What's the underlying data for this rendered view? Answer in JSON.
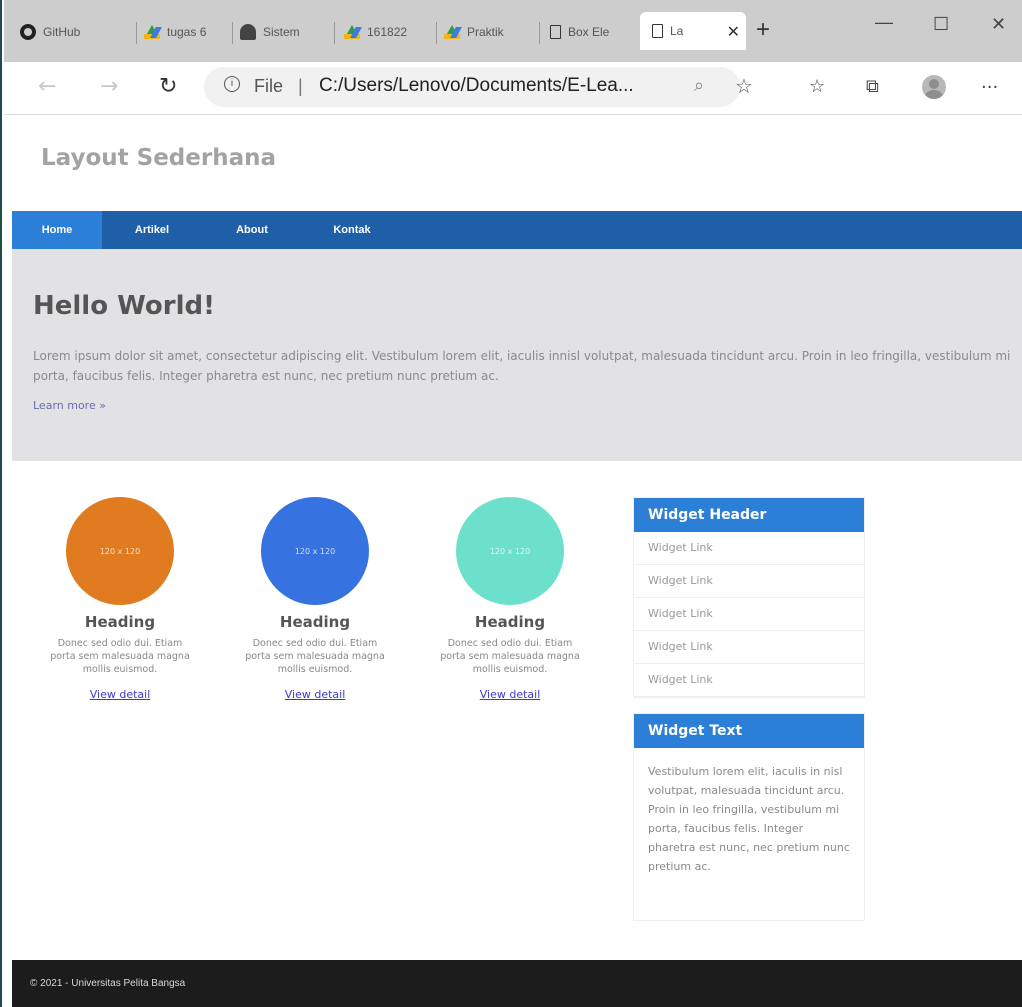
{
  "browser": {
    "tabs": [
      {
        "label": "GitHub",
        "icon": "github-icon"
      },
      {
        "label": "tugas 6",
        "icon": "google-drive-icon"
      },
      {
        "label": "Sistem",
        "icon": "hat-icon"
      },
      {
        "label": "161822",
        "icon": "google-drive-icon"
      },
      {
        "label": "Praktik",
        "icon": "google-drive-icon"
      },
      {
        "label": "Box Ele",
        "icon": "page-icon"
      },
      {
        "label": "La",
        "icon": "page-icon",
        "active": true
      }
    ],
    "new_tab": "+",
    "window_controls": {
      "minimize": "—",
      "maximize": "☐",
      "close": "✕"
    },
    "address": {
      "info": "i",
      "scheme": "File",
      "separator": "|",
      "url": "C:/Users/Lenovo/Documents/E-Lea..."
    },
    "more": "···"
  },
  "site": {
    "title": "Layout Sederhana",
    "nav": [
      "Home",
      "Artikel",
      "About",
      "Kontak"
    ],
    "hero": {
      "heading": "Hello World!",
      "text": "Lorem ipsum dolor sit amet, consectetur adipiscing elit. Vestibulum lorem elit, iaculis innisl volutpat, malesuada tincidunt arcu. Proin in leo fringilla, vestibulum mi porta, faucibus felis. Integer pharetra est nunc, nec pretium nunc pretium ac.",
      "link": "Learn more »"
    },
    "cards": [
      {
        "image_label": "120 x 120",
        "heading": "Heading",
        "text": "Donec sed odio dui. Etiam porta sem malesuada magna mollis euismod.",
        "link": "View detail",
        "color": "#e07c1f"
      },
      {
        "image_label": "120 x 120",
        "heading": "Heading",
        "text": "Donec sed odio dui. Etiam porta sem malesuada magna mollis euismod.",
        "link": "View detail",
        "color": "#3773e0"
      },
      {
        "image_label": "120 x 120",
        "heading": "Heading",
        "text": "Donec sed odio dui. Etiam porta sem malesuada magna mollis euismod.",
        "link": "View detail",
        "color": "#6de0cc"
      }
    ],
    "widget_links": {
      "header": "Widget Header",
      "links": [
        "Widget Link",
        "Widget Link",
        "Widget Link",
        "Widget Link",
        "Widget Link"
      ]
    },
    "widget_text": {
      "header": "Widget Text",
      "text": "Vestibulum lorem elit, iaculis in nisl volutpat, malesuada tincidunt arcu. Proin in leo fringilla, vestibulum mi porta, faucibus felis. Integer pharetra est nunc, nec pretium nunc pretium ac."
    },
    "footer": "© 2021 - Universitas Pelita Bangsa",
    "colors": {
      "nav": "#1e5fa8",
      "accent": "#2c7fd6",
      "footer": "#1c1c1c"
    }
  }
}
